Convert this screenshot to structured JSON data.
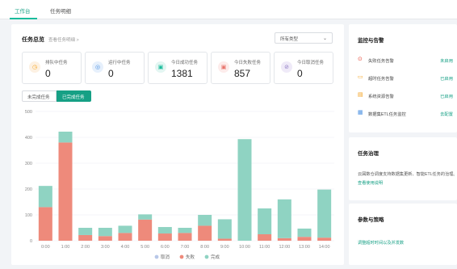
{
  "tabs": [
    {
      "label": "工作台",
      "active": true
    },
    {
      "label": "任务明细",
      "active": false
    }
  ],
  "overview": {
    "title": "任务总览",
    "detail_link": "查看任务明细 >",
    "type_select": "所有类型"
  },
  "stats": [
    {
      "label": "排队中任务",
      "value": "0",
      "icon": "queue-icon",
      "color": "#f5a623"
    },
    {
      "label": "运行中任务",
      "value": "0",
      "icon": "running-icon",
      "color": "#4a90e2"
    },
    {
      "label": "今日成功任务",
      "value": "1381",
      "icon": "success-icon",
      "color": "#1abc9c"
    },
    {
      "label": "今日失败任务",
      "value": "857",
      "icon": "failure-icon",
      "color": "#e8736b"
    },
    {
      "label": "今日取消任务",
      "value": "0",
      "icon": "cancel-icon",
      "color": "#8e7cc3"
    }
  ],
  "segments": {
    "unfinished": "未完成任务",
    "finished": "已完成任务"
  },
  "colors": {
    "accent": "#16a085",
    "cancel": "#b8c7e8",
    "fail": "#ee8a7b",
    "done": "#8fd3c2"
  },
  "chart_data": {
    "type": "bar",
    "stacked": true,
    "categories": [
      "0:00",
      "1:00",
      "2:00",
      "3:00",
      "4:00",
      "5:00",
      "6:00",
      "7:00",
      "8:00",
      "9:00",
      "10:00",
      "11:00",
      "12:00",
      "13:00",
      "14:00"
    ],
    "series": [
      {
        "name": "取消",
        "values": [
          0,
          0,
          0,
          0,
          0,
          0,
          0,
          0,
          0,
          0,
          0,
          0,
          0,
          0,
          0
        ]
      },
      {
        "name": "失败",
        "values": [
          130,
          380,
          22,
          18,
          30,
          82,
          28,
          30,
          58,
          8,
          0,
          25,
          10,
          15,
          12
        ]
      },
      {
        "name": "完成",
        "values": [
          82,
          42,
          28,
          32,
          28,
          20,
          25,
          20,
          42,
          75,
          393,
          100,
          150,
          32,
          186
        ]
      }
    ],
    "ylim": [
      0,
      500
    ],
    "yticks": [
      "0",
      "100",
      "200",
      "300",
      "400",
      "500"
    ],
    "legend": [
      "取消",
      "失败",
      "完成"
    ],
    "legend_position": "bottom",
    "grid": true
  },
  "monitor": {
    "title": "监控与告警",
    "items": [
      {
        "label": "失败任务告警",
        "status": "未启用",
        "icon": "fail-alert-icon",
        "color": "#e74c3c"
      },
      {
        "label": "超时任务告警",
        "status": "已启用",
        "icon": "timeout-alert-icon",
        "color": "#f5a623"
      },
      {
        "label": "系统资源告警",
        "status": "已启用",
        "icon": "resource-alert-icon",
        "color": "#f39c12"
      },
      {
        "label": "数据集ETL任务监控",
        "status": "去配置",
        "icon": "etl-monitor-icon",
        "color": "#4a90e2"
      }
    ]
  },
  "governance": {
    "title": "任务治理",
    "desc": "云図数仓调度支持数据集更新、智能ETL任务的治理。",
    "link": "查看使用说明"
  },
  "params": {
    "title": "参数与策略",
    "link": "调整超时时间以及并发数"
  }
}
